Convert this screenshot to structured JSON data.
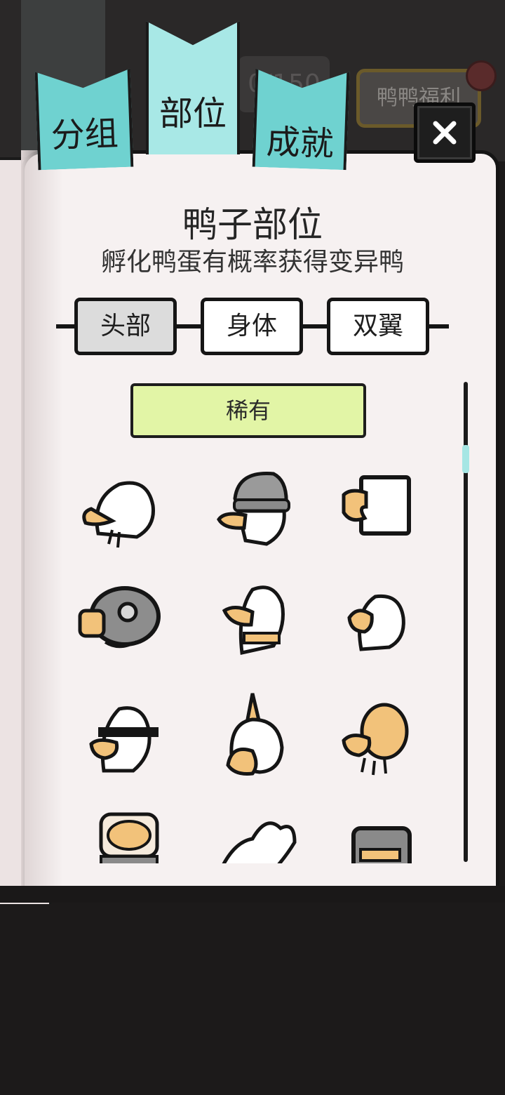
{
  "tabs": [
    {
      "label": "分组"
    },
    {
      "label": "部位",
      "active": true
    },
    {
      "label": "成就"
    }
  ],
  "background": {
    "counter_text": "0/150",
    "welfare_button_label": "鸭鸭福利"
  },
  "close_icon": "close-icon",
  "panel": {
    "title": "鸭子部位",
    "subtitle": "孵化鸭蛋有概率获得变异鸭"
  },
  "segments": [
    {
      "label": "头部",
      "active": true
    },
    {
      "label": "身体"
    },
    {
      "label": "双翼"
    }
  ],
  "rarity": {
    "label": "稀有",
    "color": "#e2f5a6"
  },
  "parts": [
    {
      "icon": "old-duck-head-icon"
    },
    {
      "icon": "beanie-duck-head-icon"
    },
    {
      "icon": "box-duck-head-icon"
    },
    {
      "icon": "gas-mask-duck-head-icon"
    },
    {
      "icon": "collar-duck-head-icon"
    },
    {
      "icon": "eagle-duck-head-icon"
    },
    {
      "icon": "sunglasses-duck-head-icon"
    },
    {
      "icon": "unicorn-duck-head-icon"
    },
    {
      "icon": "bald-duck-head-icon"
    },
    {
      "icon": "brain-jar-duck-head-icon"
    },
    {
      "icon": "flame-hair-duck-head-icon"
    },
    {
      "icon": "knight-helmet-duck-head-icon"
    }
  ],
  "colors": {
    "tab": "#a6e6e4",
    "panel": "#f6f1f1",
    "beak": "#f2c27a"
  }
}
